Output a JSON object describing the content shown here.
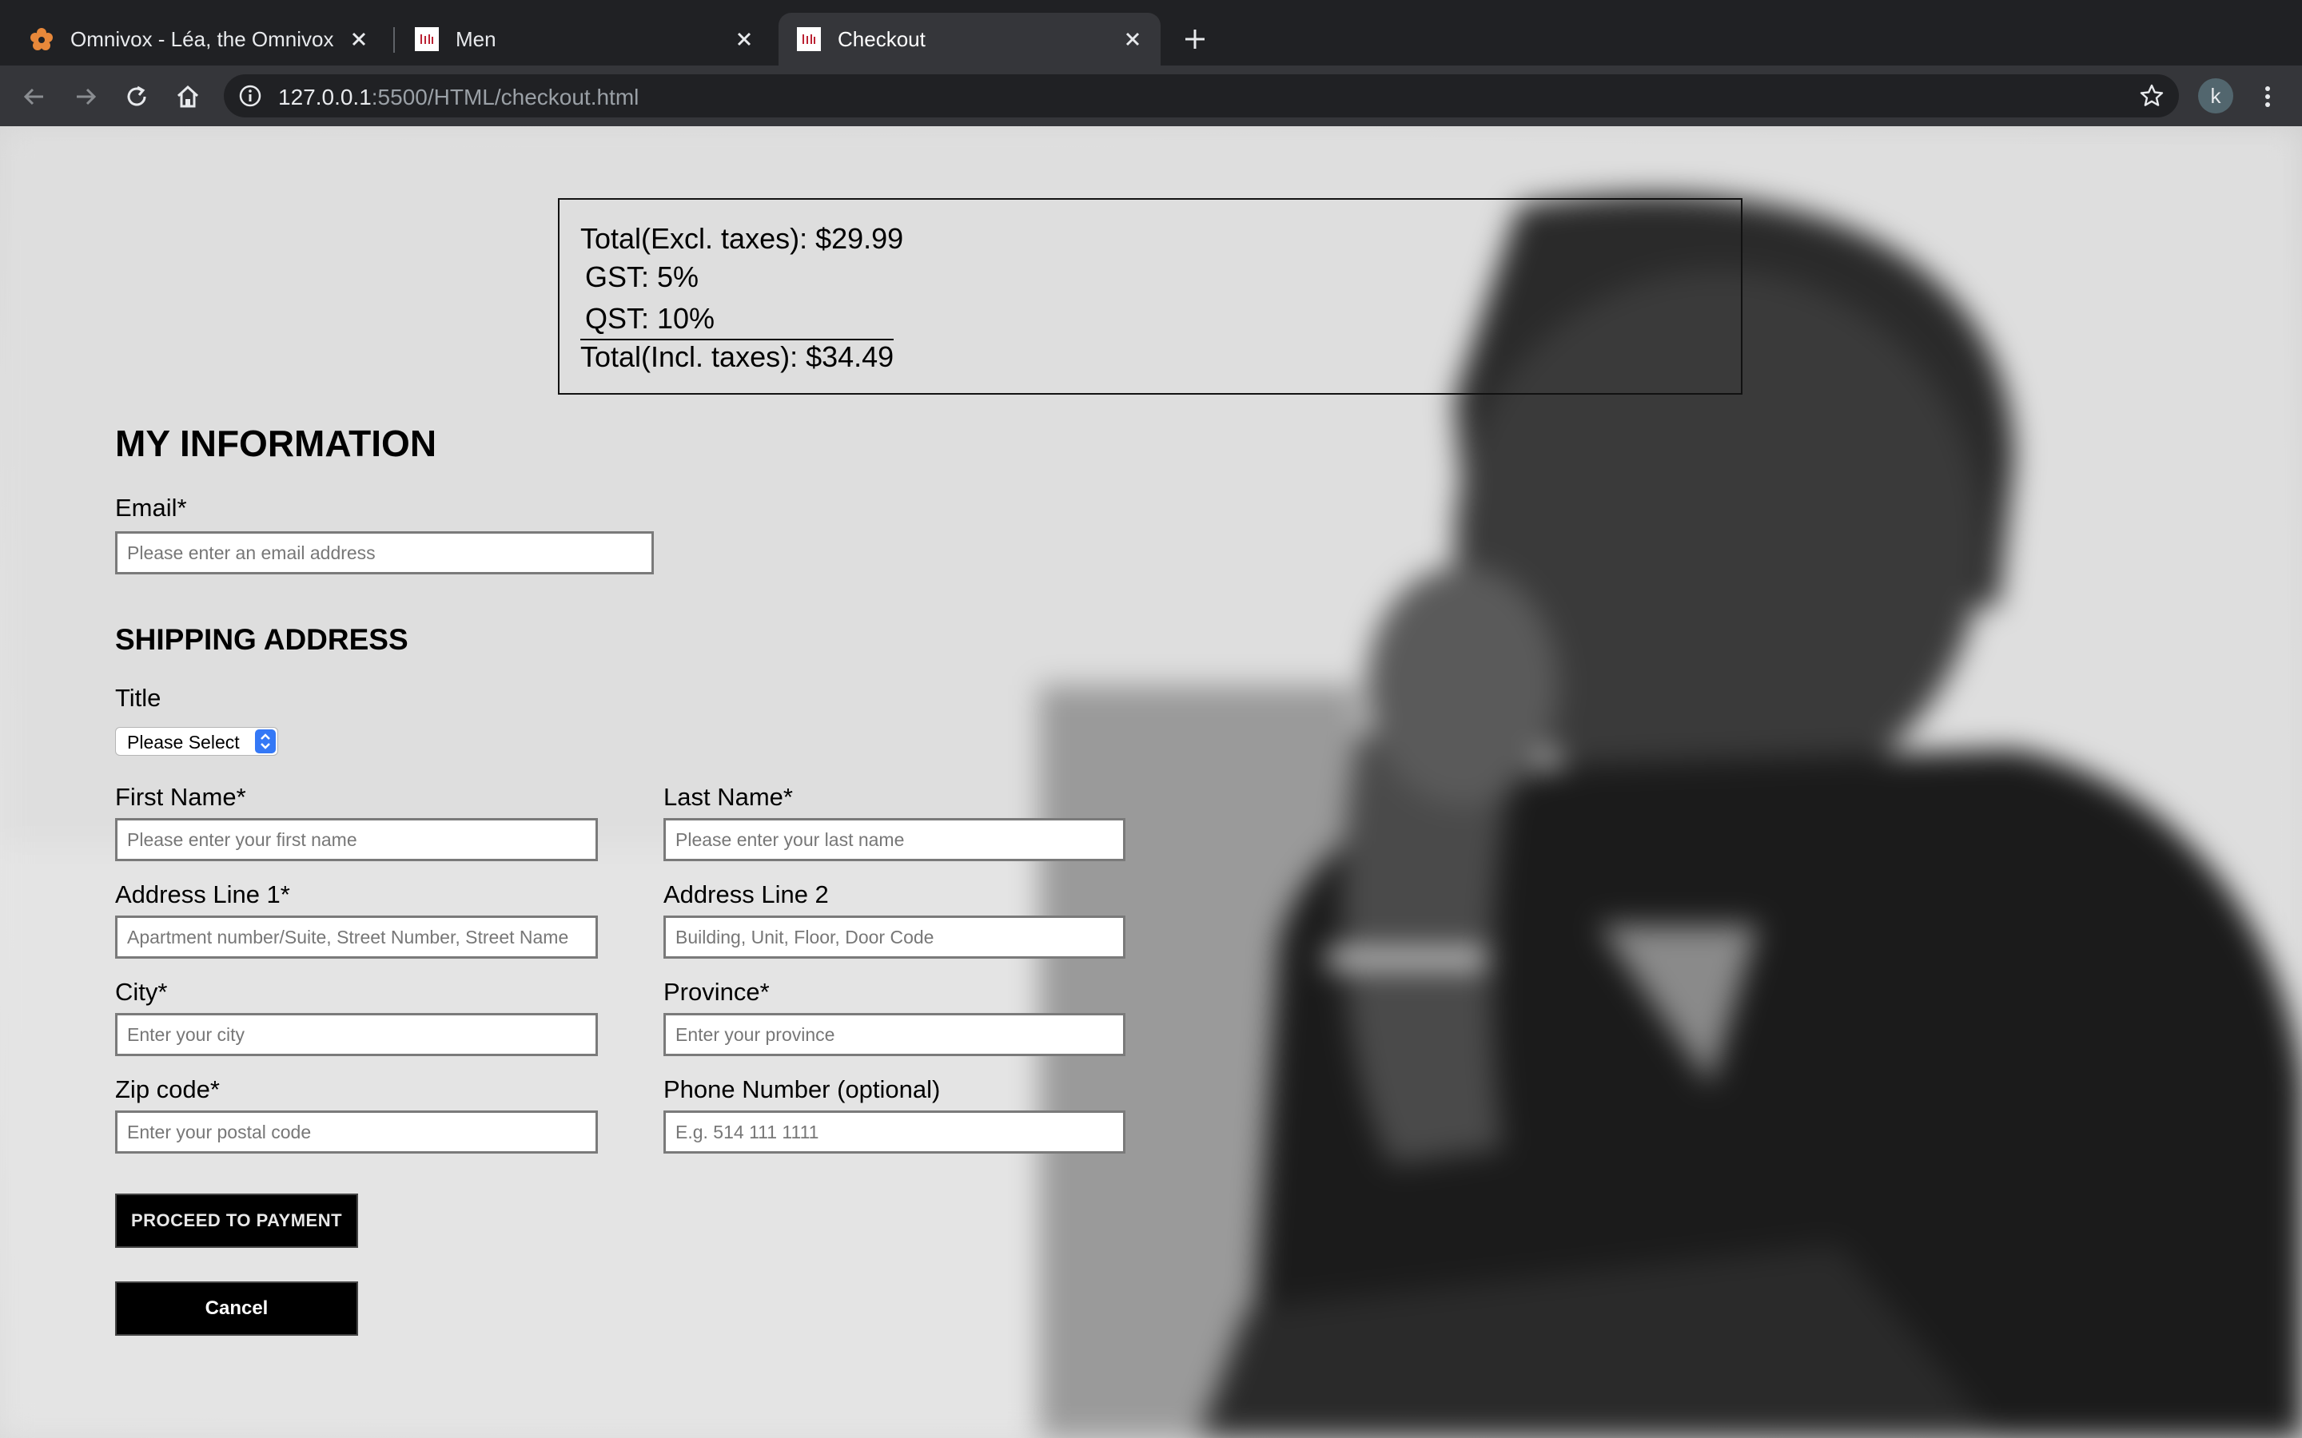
{
  "browser": {
    "tabs": [
      {
        "title": "Omnivox - Léa, the Omnivox Cl",
        "active": false
      },
      {
        "title": "Men",
        "active": false
      },
      {
        "title": "Checkout",
        "active": true
      }
    ],
    "url_host": "127.0.0.1",
    "url_rest": ":5500/HTML/checkout.html",
    "profile_initial": "k"
  },
  "summary": {
    "subtotal": "Total(Excl. taxes): $29.99",
    "gst": "GST: 5%",
    "qst": "QST: 10%",
    "total": "Total(Incl. taxes): $34.49"
  },
  "my_information": {
    "heading": "MY INFORMATION",
    "email_label": "Email*",
    "email_placeholder": "Please enter an email address"
  },
  "shipping": {
    "heading": "SHIPPING ADDRESS",
    "title_label": "Title",
    "title_value": "Please Select",
    "first_name_label": "First Name*",
    "first_name_placeholder": "Please enter your first name",
    "last_name_label": "Last Name*",
    "last_name_placeholder": "Please enter your last name",
    "address1_label": "Address Line 1*",
    "address1_placeholder": "Apartment number/Suite, Street Number, Street Name",
    "address2_label": "Address Line 2",
    "address2_placeholder": "Building, Unit, Floor, Door Code",
    "city_label": "City*",
    "city_placeholder": "Enter your city",
    "province_label": "Province*",
    "province_placeholder": "Enter your province",
    "zip_label": "Zip code*",
    "zip_placeholder": "Enter your postal code",
    "phone_label": "Phone Number (optional)",
    "phone_placeholder": "E.g. 514 111 1111"
  },
  "actions": {
    "proceed_label": "PROCEED TO PAYMENT",
    "cancel_label": "Cancel"
  },
  "icons": {
    "omnivox_favicon": "flower-icon",
    "site_favicon": "logo-icon",
    "info": "info-icon",
    "bookmark": "star-icon"
  }
}
